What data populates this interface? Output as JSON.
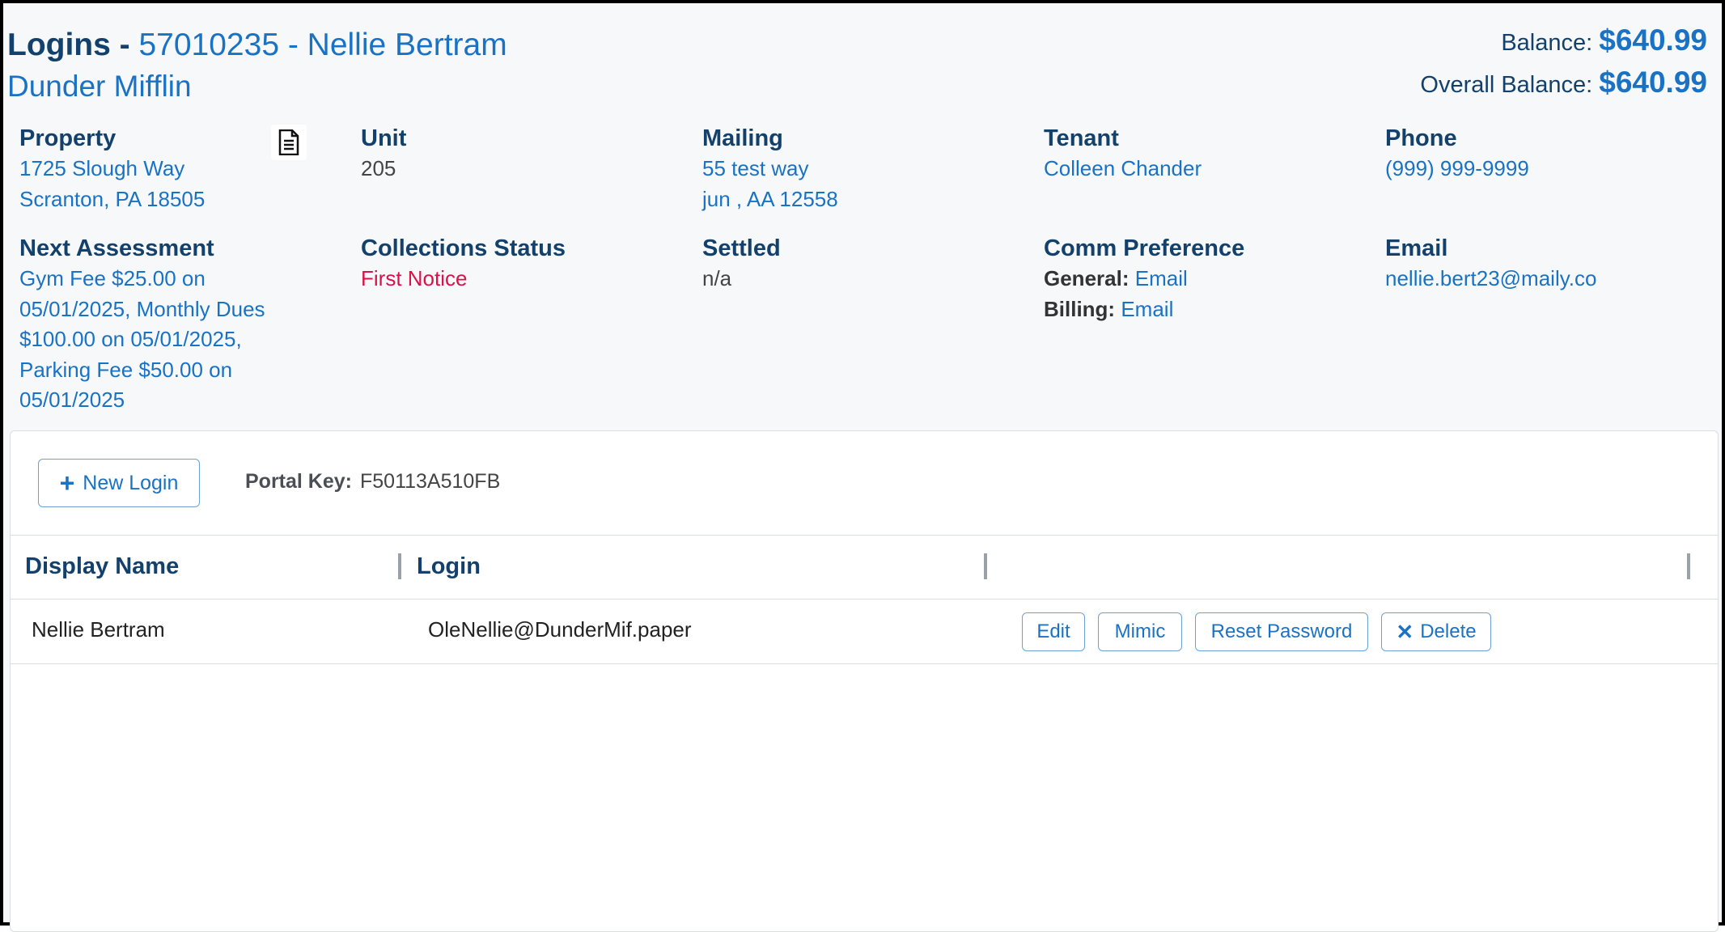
{
  "header": {
    "title_prefix": "Logins - ",
    "title_link": "57010235 - Nellie Bertram",
    "company": "Dunder Mifflin",
    "balance_label": "Balance: ",
    "balance_value": "$640.99",
    "overall_label": "Overall Balance: ",
    "overall_value": "$640.99"
  },
  "info": {
    "property": {
      "label": "Property",
      "line1": "1725 Slough Way",
      "line2": "Scranton, PA 18505",
      "icon": "document-icon"
    },
    "unit": {
      "label": "Unit",
      "value": "205"
    },
    "mailing": {
      "label": "Mailing",
      "line1": "55 test way",
      "line2": "jun , AA 12558"
    },
    "tenant": {
      "label": "Tenant",
      "value": "Colleen Chander"
    },
    "phone": {
      "label": "Phone",
      "value": "(999) 999-9999"
    },
    "next_assessment": {
      "label": "Next Assessment",
      "lines": [
        "Gym Fee $25.00 on",
        "05/01/2025, Monthly Dues",
        "$100.00 on 05/01/2025,",
        "Parking Fee $50.00 on",
        "05/01/2025"
      ]
    },
    "collections": {
      "label": "Collections Status",
      "value": "First Notice"
    },
    "settled": {
      "label": "Settled",
      "value": "n/a"
    },
    "comm": {
      "label": "Comm Preference",
      "general_label": "General:",
      "general_value": "Email",
      "billing_label": "Billing:",
      "billing_value": "Email"
    },
    "email": {
      "label": "Email",
      "value": "nellie.bert23@maily.co"
    }
  },
  "logins": {
    "new_login_label": "New Login",
    "portal_key_label": "Portal Key:",
    "portal_key_value": "F50113A510FB",
    "columns": [
      "Display Name",
      "Login",
      ""
    ],
    "rows": [
      {
        "display_name": "Nellie Bertram",
        "login": "OleNellie@DunderMif.paper",
        "actions": [
          "Edit",
          "Mimic",
          "Reset Password",
          "Delete"
        ]
      }
    ]
  },
  "colors": {
    "navy": "#13416b",
    "link": "#1a72c4",
    "alert": "#d9124a",
    "background": "#f7f8fa"
  }
}
